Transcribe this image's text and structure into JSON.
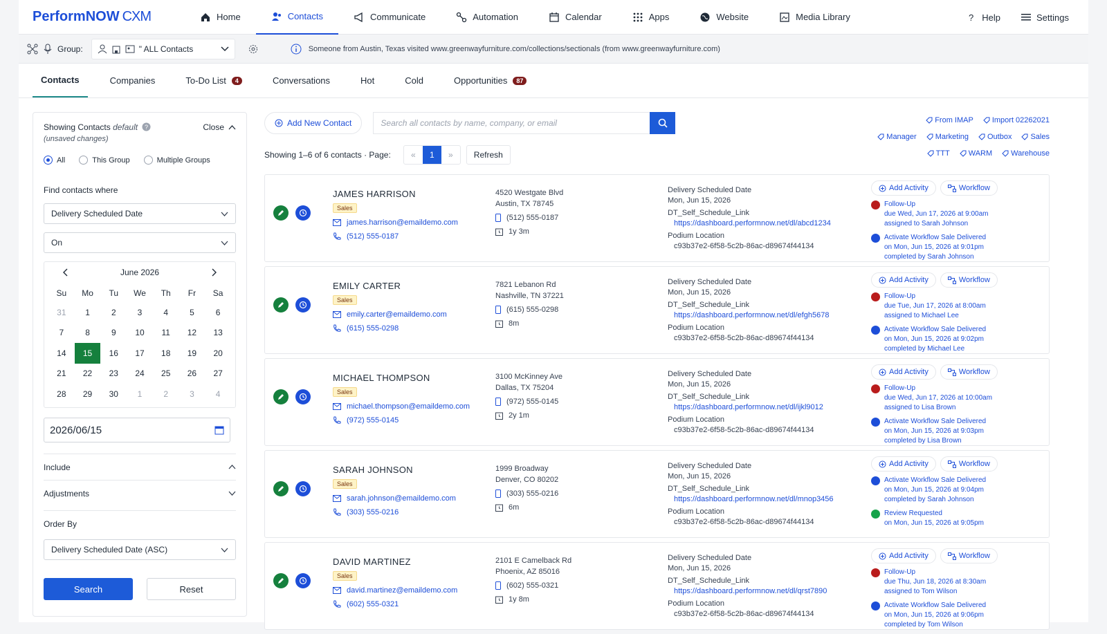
{
  "app": {
    "brand": "PerformNOW",
    "brand_suffix": "CXM"
  },
  "nav": [
    {
      "label": "Home",
      "icon": "home-icon"
    },
    {
      "label": "Contacts",
      "icon": "contacts-icon"
    },
    {
      "label": "Communicate",
      "icon": "megaphone-icon"
    },
    {
      "label": "Automation",
      "icon": "automation-icon"
    },
    {
      "label": "Calendar",
      "icon": "calendar-icon"
    },
    {
      "label": "Apps",
      "icon": "grid-icon"
    },
    {
      "label": "Website",
      "icon": "globe-icon"
    },
    {
      "label": "Media Library",
      "icon": "media-icon"
    }
  ],
  "nav_right": {
    "help": "Help",
    "settings": "Settings"
  },
  "subbar": {
    "group_label": "Group:",
    "group_value": "\" ALL Contacts",
    "visit_message": "Someone from Austin, Texas visited www.greenwayfurniture.com/collections/sectionals (from www.greenwayfurniture.com)"
  },
  "tabs": [
    {
      "label": "Contacts",
      "badge": ""
    },
    {
      "label": "Companies",
      "badge": ""
    },
    {
      "label": "To-Do List",
      "badge": "4"
    },
    {
      "label": "Conversations",
      "badge": ""
    },
    {
      "label": "Hot",
      "badge": ""
    },
    {
      "label": "Cold",
      "badge": ""
    },
    {
      "label": "Opportunities",
      "badge": "87"
    }
  ],
  "filter": {
    "showing_label": "Showing Contacts",
    "showing_mode": "default",
    "unsaved": "(unsaved changes)",
    "close": "Close",
    "radios": [
      "All",
      "This Group",
      "Multiple Groups"
    ],
    "find_label": "Find contacts where",
    "field_select": "Delivery Scheduled Date",
    "operator_select": "On",
    "calendar": {
      "month": "June 2026",
      "dow": [
        "Su",
        "Mo",
        "Tu",
        "We",
        "Th",
        "Fr",
        "Sa"
      ],
      "weeks": [
        [
          "31",
          "1",
          "2",
          "3",
          "4",
          "5",
          "6"
        ],
        [
          "7",
          "8",
          "9",
          "10",
          "11",
          "12",
          "13"
        ],
        [
          "14",
          "15",
          "16",
          "17",
          "18",
          "19",
          "20"
        ],
        [
          "21",
          "22",
          "23",
          "24",
          "25",
          "26",
          "27"
        ],
        [
          "28",
          "29",
          "30",
          "1",
          "2",
          "3",
          "4"
        ]
      ]
    },
    "date_value": "2026/06/15",
    "include": "Include",
    "adjustments": "Adjustments",
    "order_by_label": "Order By",
    "order_by_value": "Delivery Scheduled Date (ASC)",
    "search_btn": "Search",
    "reset_btn": "Reset"
  },
  "toolbar": {
    "add_new": "Add New Contact",
    "search_placeholder": "Search all contacts by name, company, or email",
    "showing": "Showing 1–6 of 6 contacts · Page:",
    "page_prev": "«",
    "page_current": "1",
    "page_next": "»",
    "refresh": "Refresh"
  },
  "tag_rows": [
    [
      "From IMAP",
      "Import 02262021"
    ],
    [
      "Manager",
      "Marketing",
      "Outbox",
      "Sales"
    ],
    [
      "TTT",
      "WARM",
      "Warehouse"
    ]
  ],
  "field_labels": {
    "delivery": "Delivery Scheduled Date",
    "schedule_link": "DT_Self_Schedule_Link",
    "podium": "Podium Location",
    "add_activity": "Add Activity",
    "workflow": "Workflow"
  },
  "contacts": [
    {
      "name": "JAMES HARRISON",
      "badge": "Sales",
      "email": "james.harrison@emaildemo.com",
      "phone": "(512) 555-0187",
      "addr1": "4520 Westgate Blvd",
      "addr2": "Austin, TX 78745",
      "mobile": "(512) 555-0187",
      "tenure": "1y 3m",
      "delivery": "Mon, Jun 15, 2026",
      "link": "https://dashboard.performnow.net/dl/abcd1234",
      "podium": "c93b37e2-6f58-5c2b-86ac-d89674f44134",
      "activities": [
        {
          "color": "red",
          "lines": [
            "Follow-Up",
            "due Wed, Jun 17, 2026 at 9:00am",
            "assigned to Sarah Johnson"
          ]
        },
        {
          "color": "bl",
          "lines": [
            "Activate Workflow Sale Delivered",
            "on Mon, Jun 15, 2026 at 9:01pm",
            "completed by Sarah Johnson"
          ]
        }
      ]
    },
    {
      "name": "EMILY CARTER",
      "badge": "Sales",
      "email": "emily.carter@emaildemo.com",
      "phone": "(615) 555-0298",
      "addr1": "7821 Lebanon Rd",
      "addr2": "Nashville, TN 37221",
      "mobile": "(615) 555-0298",
      "tenure": "8m",
      "delivery": "Mon, Jun 15, 2026",
      "link": "https://dashboard.performnow.net/dl/efgh5678",
      "podium": "c93b37e2-6f58-5c2b-86ac-d89674f44134",
      "activities": [
        {
          "color": "red",
          "lines": [
            "Follow-Up",
            "due Tue, Jun 17, 2026 at 8:00am",
            "assigned to Michael Lee"
          ]
        },
        {
          "color": "bl",
          "lines": [
            "Activate Workflow Sale Delivered",
            "on Mon, Jun 15, 2026 at 9:02pm",
            "completed by Michael Lee"
          ]
        }
      ]
    },
    {
      "name": "MICHAEL THOMPSON",
      "badge": "Sales",
      "email": "michael.thompson@emaildemo.com",
      "phone": "(972) 555-0145",
      "addr1": "3100 McKinney Ave",
      "addr2": "Dallas, TX 75204",
      "mobile": "(972) 555-0145",
      "tenure": "2y 1m",
      "delivery": "Mon, Jun 15, 2026",
      "link": "https://dashboard.performnow.net/dl/ijkl9012",
      "podium": "c93b37e2-6f58-5c2b-86ac-d89674f44134",
      "activities": [
        {
          "color": "red",
          "lines": [
            "Follow-Up",
            "due Wed, Jun 17, 2026 at 10:00am",
            "assigned to Lisa Brown"
          ]
        },
        {
          "color": "bl",
          "lines": [
            "Activate Workflow Sale Delivered",
            "on Mon, Jun 15, 2026 at 9:03pm",
            "completed by Lisa Brown"
          ]
        }
      ]
    },
    {
      "name": "SARAH JOHNSON",
      "badge": "Sales",
      "email": "sarah.johnson@emaildemo.com",
      "phone": "(303) 555-0216",
      "addr1": "1999 Broadway",
      "addr2": "Denver, CO 80202",
      "mobile": "(303) 555-0216",
      "tenure": "6m",
      "delivery": "Mon, Jun 15, 2026",
      "link": "https://dashboard.performnow.net/dl/mnop3456",
      "podium": "c93b37e2-6f58-5c2b-86ac-d89674f44134",
      "activities": [
        {
          "color": "bl",
          "lines": [
            "Activate Workflow Sale Delivered",
            "on Mon, Jun 15, 2026 at 9:04pm",
            "completed by Sarah Johnson"
          ]
        },
        {
          "color": "gr",
          "lines": [
            "Review Requested",
            "on Mon, Jun 15, 2026 at 9:05pm"
          ]
        }
      ]
    },
    {
      "name": "DAVID MARTINEZ",
      "badge": "Sales",
      "email": "david.martinez@emaildemo.com",
      "phone": "(602) 555-0321",
      "addr1": "2101 E Camelback Rd",
      "addr2": "Phoenix, AZ 85016",
      "mobile": "(602) 555-0321",
      "tenure": "1y 8m",
      "delivery": "Mon, Jun 15, 2026",
      "link": "https://dashboard.performnow.net/dl/qrst7890",
      "podium": "c93b37e2-6f58-5c2b-86ac-d89674f44134",
      "activities": [
        {
          "color": "red",
          "lines": [
            "Follow-Up",
            "due Thu, Jun 18, 2026 at 8:30am",
            "assigned to Tom Wilson"
          ]
        },
        {
          "color": "bl",
          "lines": [
            "Activate Workflow Sale Delivered",
            "on Mon, Jun 15, 2026 at 9:06pm",
            "completed by Tom Wilson"
          ]
        }
      ]
    }
  ],
  "colors": {
    "accent": "#1d4ed8",
    "primary_button": "#1d5bd8",
    "selected_day": "#15803d",
    "badge": "#7f1d1d"
  }
}
